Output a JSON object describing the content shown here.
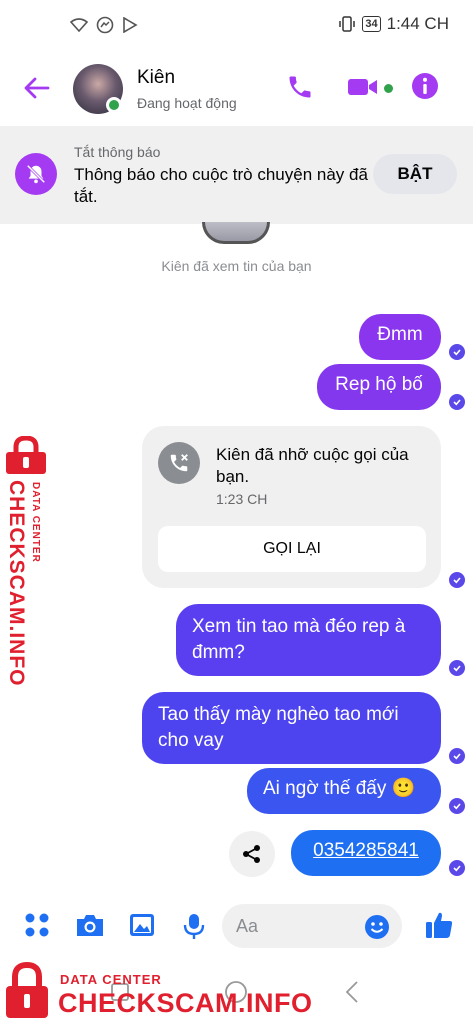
{
  "status_bar": {
    "battery": "34",
    "time": "1:44 CH"
  },
  "header": {
    "contact_name": "Kiên",
    "contact_status": "Đang hoạt động"
  },
  "notice": {
    "title": "Tắt thông báo",
    "text": "Thông báo cho cuộc trò chuyện này đã tắt.",
    "button_label": "BẬT"
  },
  "chat": {
    "seen_text": "Kiên đã xem tin của bạn",
    "messages": [
      {
        "text": "Đmm"
      },
      {
        "text": "Rep hộ bố"
      },
      {
        "text": "Xem tin tao mà đéo rep à đmm?"
      },
      {
        "text": "Tao thấy mày nghèo tao mới cho vay"
      },
      {
        "text": "Ai ngờ thế đấy 🙂"
      },
      {
        "text": "0354285841"
      }
    ],
    "missed_call": {
      "text": "Kiên đã nhỡ cuộc gọi của bạn.",
      "time": "1:23 CH",
      "button_label": "GỌI LẠI"
    }
  },
  "composer": {
    "placeholder": "Aa"
  },
  "watermark": {
    "small": "DATA CENTER",
    "big": "CHECKSCAM.INFO"
  },
  "colors": {
    "accent": "#a43bf2",
    "bubble_top": "#7b3ff0",
    "bubble_bottom": "#1f6ff2",
    "online": "#31a24c"
  }
}
